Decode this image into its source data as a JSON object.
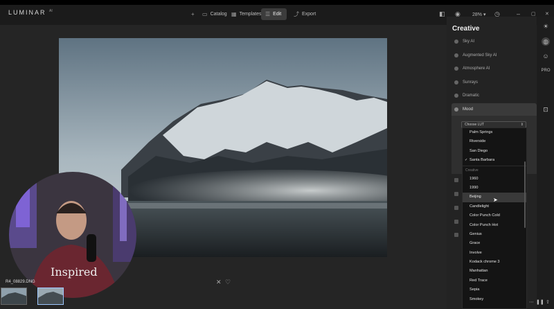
{
  "app": {
    "brand": "LUMINAR",
    "brand_sup": "AI"
  },
  "toolbar": {
    "items": [
      {
        "label": "Catalog",
        "icon": "folder-icon"
      },
      {
        "label": "Templates",
        "icon": "templates-icon"
      },
      {
        "label": "Edit",
        "icon": "sliders-icon",
        "active": true
      },
      {
        "label": "Export",
        "icon": "export-icon"
      }
    ],
    "zoom": "28%",
    "window_min": "–",
    "window_max": "▢",
    "window_close": "✕"
  },
  "photo": {
    "filename": "R4_08829.DNG"
  },
  "panel": {
    "title": "Creative",
    "tools": [
      {
        "label": "Sky AI"
      },
      {
        "label": "Augmented Sky AI"
      },
      {
        "label": "Atmosphere AI"
      },
      {
        "label": "Sunrays"
      },
      {
        "label": "Dramatic"
      },
      {
        "label": "Mood"
      }
    ],
    "lut_select": "Choose LUT"
  },
  "dropdown": {
    "items_top": [
      "Palm Springs",
      "Riverside",
      "San Diego",
      "Santa Barbara"
    ],
    "selected": "Santa Barbara",
    "group_header": "Creative",
    "items_creative": [
      "1960",
      "1990",
      "Beijing",
      "Candlelight",
      "Color Punch Cold",
      "Color Punch Hot",
      "Genius",
      "Grace",
      "Involve",
      "Kodack chrome  3",
      "Manhattan",
      "Red Trace",
      "Sepia",
      "Smokey"
    ],
    "hovered": "Beijing"
  },
  "colors": {
    "accent": "#3c3c3c",
    "background": "#1e1e1e",
    "panel": "#232323"
  }
}
